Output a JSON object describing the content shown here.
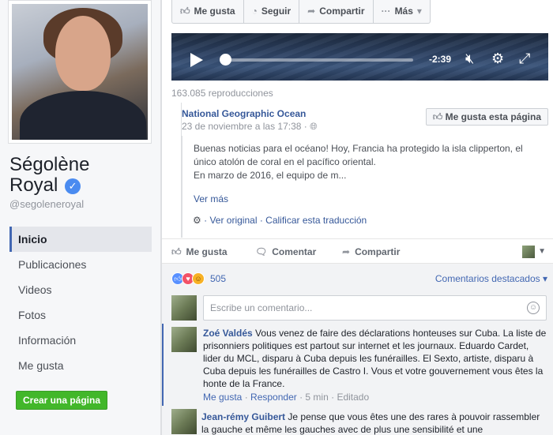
{
  "profile": {
    "name_line1": "Ségolène",
    "name_line2": "Royal",
    "verified_icon": "check-icon",
    "handle": "@segoleneroyal"
  },
  "sidebar": {
    "items": [
      {
        "label": "Inicio",
        "active": true
      },
      {
        "label": "Publicaciones"
      },
      {
        "label": "Videos"
      },
      {
        "label": "Fotos"
      },
      {
        "label": "Información"
      },
      {
        "label": "Me gusta"
      }
    ],
    "create_page": "Crear una página"
  },
  "toolbar": {
    "like": "Me gusta",
    "follow": "Seguir",
    "share": "Compartir",
    "more": "Más"
  },
  "video": {
    "time": "-2:39",
    "progress": 0.03,
    "views": "163.085 reproducciones"
  },
  "shared_post": {
    "source": "National Geographic Ocean",
    "date": "23 de noviembre a las 17:38 · ",
    "like_page": "Me gusta esta página",
    "text_p1": "Buenas noticias para el océano! Hoy, Francia ha protegido la isla clipperton, el único atolón de coral en el pacífico oriental.",
    "text_p2": "En marzo de 2016, el equipo de m...",
    "see_more": "Ver más",
    "see_original": "Ver original",
    "rate_translation": "Calificar esta traducción",
    "separator": " · "
  },
  "actions": {
    "like": "Me gusta",
    "comment": "Comentar",
    "share": "Compartir"
  },
  "reactions": {
    "count": "505",
    "top_comments": "Comentarios destacados"
  },
  "comment_box": {
    "placeholder": "Escribe un comentario..."
  },
  "comments": [
    {
      "author": "Zoé Valdés",
      "text": "Vous venez de faire des déclarations honteuses sur Cuba. La liste de prisonniers politiques est partout sur internet et les journaux. Eduardo Cardet, lider du MCL, disparu à Cuba depuis les funérailles. El Sexto, artiste, disparu à Cuba depuis les funérailles de Castro I. Vous et votre gouvernement vous êtes la honte de la France.",
      "like": "Me gusta",
      "reply": "Responder",
      "time": "5 min",
      "edited": "Editado",
      "sep": " · "
    },
    {
      "author": "Jean-rémy Guibert",
      "text": "Je pense que vous êtes une des rares à pouvoir rassembler la gauche et même les gauches avec de plus une sensibilité et une"
    }
  ],
  "colors": {
    "link_blue": "#365899",
    "facebook_blue": "#4267b2",
    "green_button": "#42b72a"
  }
}
